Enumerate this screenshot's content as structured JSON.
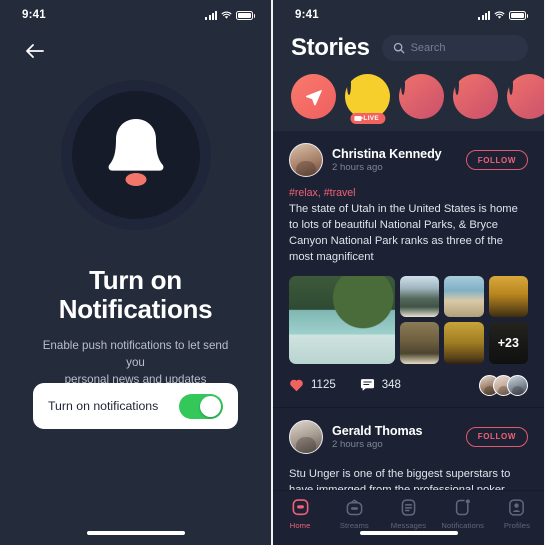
{
  "status_bar": {
    "time": "9:41",
    "signal_icon": "cellular-bars-icon",
    "wifi_icon": "wifi-icon",
    "battery_icon": "battery-full-icon"
  },
  "left_screen": {
    "back_icon": "arrow-left-icon",
    "illustration_icon": "bell-icon",
    "headline_line1": "Turn on",
    "headline_line2": "Notifications",
    "subtext_line1": "Enable push notifications to let send you",
    "subtext_line2": "personal news and updates",
    "toggle": {
      "label": "Turn on notifications",
      "state": "on",
      "on_color": "#34c85a"
    }
  },
  "right_screen": {
    "title": "Stories",
    "search": {
      "placeholder": "Search",
      "value": "",
      "icon": "search-icon"
    },
    "stories": [
      {
        "name": "add-story",
        "type": "send",
        "icon": "paper-plane-icon",
        "label": ""
      },
      {
        "name": "story-live-user",
        "type": "avatar",
        "ring": "yellow",
        "badge": "LIVE",
        "badge_icon": "video-camera-icon"
      },
      {
        "name": "story-user-2",
        "type": "avatar",
        "ring": "gradient"
      },
      {
        "name": "story-user-3",
        "type": "avatar",
        "ring": "gradient"
      },
      {
        "name": "story-user-4",
        "type": "avatar",
        "ring": "gradient"
      }
    ],
    "posts": [
      {
        "author": "Christina Kennedy",
        "time": "2 hours ago",
        "follow_label": "FOLLOW",
        "tags": "#relax, #travel",
        "body": "The state of Utah in the United States is home to lots of beautiful National Parks, & Bryce Canyon National Park ranks as three of the most magnificent",
        "gallery_overflow": "+23",
        "likes": "1125",
        "likes_icon": "heart-icon",
        "comments": "348",
        "comments_icon": "comment-bubble-icon",
        "reactors_count": 3
      },
      {
        "author": "Gerald Thomas",
        "time": "2 hours ago",
        "follow_label": "FOLLOW",
        "tags": "",
        "body": "Stu Unger is one of the biggest superstars to have immerged from the professional poker world"
      }
    ],
    "bottom_nav": [
      {
        "label": "Home",
        "icon": "home-icon",
        "active": true
      },
      {
        "label": "Streams",
        "icon": "tv-icon",
        "active": false
      },
      {
        "label": "Messages",
        "icon": "message-document-icon",
        "active": false
      },
      {
        "label": "Notifications",
        "icon": "bell-outline-icon",
        "active": false
      },
      {
        "label": "Profiles",
        "icon": "person-square-icon",
        "active": false
      }
    ]
  },
  "colors": {
    "background": "#242b3b",
    "card": "#1c2233",
    "accent": "#ef6177",
    "accent_border": "#e05a6e",
    "toggle_green": "#34c85a",
    "muted_text": "#7d8599"
  }
}
